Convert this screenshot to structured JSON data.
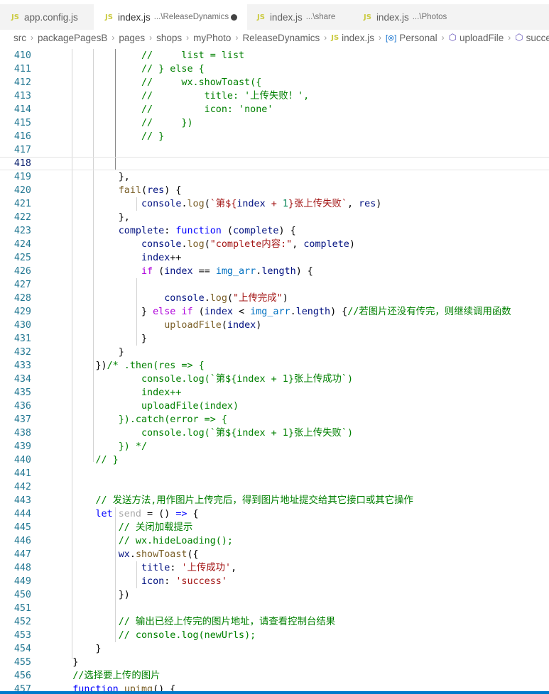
{
  "tabs": [
    {
      "icon": "JS",
      "label": "app.config.js",
      "desc": "",
      "active": false,
      "dirty": false
    },
    {
      "icon": "JS",
      "label": "index.js",
      "desc": "...\\ReleaseDynamics",
      "active": true,
      "dirty": true
    },
    {
      "icon": "JS",
      "label": "index.js",
      "desc": "...\\share",
      "active": false,
      "dirty": false
    },
    {
      "icon": "JS",
      "label": "index.js",
      "desc": "...\\Photos",
      "active": false,
      "dirty": false
    }
  ],
  "breadcrumb": [
    {
      "text": "src",
      "icon": ""
    },
    {
      "text": "packagePagesB",
      "icon": ""
    },
    {
      "text": "pages",
      "icon": ""
    },
    {
      "text": "shops",
      "icon": ""
    },
    {
      "text": "myPhoto",
      "icon": ""
    },
    {
      "text": "ReleaseDynamics",
      "icon": ""
    },
    {
      "text": "index.js",
      "icon": "js-file-icon"
    },
    {
      "text": "Personal",
      "icon": "variable-icon"
    },
    {
      "text": "uploadFile",
      "icon": "method-cube-icon"
    },
    {
      "text": "success",
      "icon": "method-cube-icon"
    }
  ],
  "current_line": 418,
  "code_lines": [
    {
      "n": 410,
      "toks": [
        [
          "c",
          "                //     list = list"
        ]
      ]
    },
    {
      "n": 411,
      "toks": [
        [
          "c",
          "                // } else {"
        ]
      ]
    },
    {
      "n": 412,
      "toks": [
        [
          "c",
          "                //     wx.showToast({"
        ]
      ]
    },
    {
      "n": 413,
      "toks": [
        [
          "c",
          "                //         title: '上传失败！',"
        ]
      ]
    },
    {
      "n": 414,
      "toks": [
        [
          "c",
          "                //         icon: 'none'"
        ]
      ]
    },
    {
      "n": 415,
      "toks": [
        [
          "c",
          "                //     })"
        ]
      ]
    },
    {
      "n": 416,
      "toks": [
        [
          "c",
          "                // }"
        ]
      ]
    },
    {
      "n": 417,
      "toks": []
    },
    {
      "n": 418,
      "toks": []
    },
    {
      "n": 419,
      "toks": [
        [
          "p",
          "            },"
        ]
      ]
    },
    {
      "n": 420,
      "toks": [
        [
          "p",
          "            "
        ],
        [
          "f",
          "fail"
        ],
        [
          "p",
          "("
        ],
        [
          "v",
          "res"
        ],
        [
          "p",
          ") {"
        ]
      ]
    },
    {
      "n": 421,
      "toks": [
        [
          "p",
          "                "
        ],
        [
          "v",
          "console"
        ],
        [
          "p",
          "."
        ],
        [
          "f",
          "log"
        ],
        [
          "p",
          "("
        ],
        [
          "s",
          "`第${"
        ],
        [
          "v",
          "index"
        ],
        [
          "s",
          " + "
        ],
        [
          "n",
          "1"
        ],
        [
          "s",
          "}张上传失败`"
        ],
        [
          "p",
          ", "
        ],
        [
          "v",
          "res"
        ],
        [
          "p",
          ")"
        ]
      ]
    },
    {
      "n": 422,
      "toks": [
        [
          "p",
          "            },"
        ]
      ]
    },
    {
      "n": 423,
      "toks": [
        [
          "p",
          "            "
        ],
        [
          "v",
          "complete"
        ],
        [
          "p",
          ": "
        ],
        [
          "k",
          "function"
        ],
        [
          "p",
          " ("
        ],
        [
          "v",
          "complete"
        ],
        [
          "p",
          ") {"
        ]
      ]
    },
    {
      "n": 424,
      "toks": [
        [
          "p",
          "                "
        ],
        [
          "v",
          "console"
        ],
        [
          "p",
          "."
        ],
        [
          "f",
          "log"
        ],
        [
          "p",
          "("
        ],
        [
          "s",
          "\"complete内容:\""
        ],
        [
          "p",
          ", "
        ],
        [
          "v",
          "complete"
        ],
        [
          "p",
          ")"
        ]
      ]
    },
    {
      "n": 425,
      "toks": [
        [
          "p",
          "                "
        ],
        [
          "v",
          "index"
        ],
        [
          "p",
          "++"
        ]
      ]
    },
    {
      "n": 426,
      "toks": [
        [
          "p",
          "                "
        ],
        [
          "m",
          "if"
        ],
        [
          "p",
          " ("
        ],
        [
          "v",
          "index"
        ],
        [
          "p",
          " == "
        ],
        [
          "pl",
          "img_arr"
        ],
        [
          "p",
          "."
        ],
        [
          "v",
          "length"
        ],
        [
          "p",
          ") {"
        ]
      ]
    },
    {
      "n": 427,
      "toks": []
    },
    {
      "n": 428,
      "toks": [
        [
          "p",
          "                    "
        ],
        [
          "v",
          "console"
        ],
        [
          "p",
          "."
        ],
        [
          "f",
          "log"
        ],
        [
          "p",
          "("
        ],
        [
          "s",
          "\"上传完成\""
        ],
        [
          "p",
          ")"
        ]
      ]
    },
    {
      "n": 429,
      "toks": [
        [
          "p",
          "                } "
        ],
        [
          "m",
          "else if"
        ],
        [
          "p",
          " ("
        ],
        [
          "v",
          "index"
        ],
        [
          "p",
          " < "
        ],
        [
          "pl",
          "img_arr"
        ],
        [
          "p",
          "."
        ],
        [
          "v",
          "length"
        ],
        [
          "p",
          ") {"
        ],
        [
          "c",
          "//若图片还没有传完，则继续调用函数"
        ]
      ]
    },
    {
      "n": 430,
      "toks": [
        [
          "p",
          "                    "
        ],
        [
          "f",
          "uploadFile"
        ],
        [
          "p",
          "("
        ],
        [
          "v",
          "index"
        ],
        [
          "p",
          ")"
        ]
      ]
    },
    {
      "n": 431,
      "toks": [
        [
          "p",
          "                }"
        ]
      ]
    },
    {
      "n": 432,
      "toks": [
        [
          "p",
          "            }"
        ]
      ]
    },
    {
      "n": 433,
      "toks": [
        [
          "p",
          "        })"
        ],
        [
          "c",
          "/* .then(res => {"
        ]
      ]
    },
    {
      "n": 434,
      "toks": [
        [
          "c",
          "                console.log(`第${index + 1}张上传成功`)"
        ]
      ]
    },
    {
      "n": 435,
      "toks": [
        [
          "c",
          "                index++"
        ]
      ]
    },
    {
      "n": 436,
      "toks": [
        [
          "c",
          "                uploadFile(index)"
        ]
      ]
    },
    {
      "n": 437,
      "toks": [
        [
          "c",
          "            }).catch(error => {"
        ]
      ]
    },
    {
      "n": 438,
      "toks": [
        [
          "c",
          "                console.log(`第${index + 1}张上传失败`)"
        ]
      ]
    },
    {
      "n": 439,
      "toks": [
        [
          "c",
          "            }) */"
        ]
      ]
    },
    {
      "n": 440,
      "toks": [
        [
          "c",
          "        // }"
        ]
      ]
    },
    {
      "n": 441,
      "toks": []
    },
    {
      "n": 442,
      "toks": []
    },
    {
      "n": 443,
      "toks": [
        [
          "c",
          "        // 发送方法,用作图片上传完后，得到图片地址提交给其它接口或其它操作"
        ]
      ]
    },
    {
      "n": 444,
      "toks": [
        [
          "p",
          "        "
        ],
        [
          "k",
          "let"
        ],
        [
          "p",
          " "
        ],
        [
          "un",
          "send"
        ],
        [
          "p",
          " = () "
        ],
        [
          "k",
          "=>"
        ],
        [
          "p",
          " {"
        ]
      ]
    },
    {
      "n": 445,
      "toks": [
        [
          "c",
          "            // 关闭加载提示"
        ]
      ]
    },
    {
      "n": 446,
      "toks": [
        [
          "c",
          "            // wx.hideLoading();"
        ]
      ]
    },
    {
      "n": 447,
      "toks": [
        [
          "p",
          "            "
        ],
        [
          "v",
          "wx"
        ],
        [
          "p",
          "."
        ],
        [
          "f",
          "showToast"
        ],
        [
          "p",
          "({"
        ]
      ]
    },
    {
      "n": 448,
      "toks": [
        [
          "p",
          "                "
        ],
        [
          "v",
          "title"
        ],
        [
          "p",
          ": "
        ],
        [
          "s",
          "'上传成功'"
        ],
        [
          "p",
          ","
        ]
      ]
    },
    {
      "n": 449,
      "toks": [
        [
          "p",
          "                "
        ],
        [
          "v",
          "icon"
        ],
        [
          "p",
          ": "
        ],
        [
          "s",
          "'success'"
        ]
      ]
    },
    {
      "n": 450,
      "toks": [
        [
          "p",
          "            })"
        ]
      ]
    },
    {
      "n": 451,
      "toks": []
    },
    {
      "n": 452,
      "toks": [
        [
          "c",
          "            // 输出已经上传完的图片地址，请查看控制台结果"
        ]
      ]
    },
    {
      "n": 453,
      "toks": [
        [
          "c",
          "            // console.log(newUrls);"
        ]
      ]
    },
    {
      "n": 454,
      "toks": [
        [
          "p",
          "        }"
        ]
      ]
    },
    {
      "n": 455,
      "toks": [
        [
          "p",
          "    }"
        ]
      ]
    },
    {
      "n": 456,
      "toks": [
        [
          "c",
          "    //选择要上传的图片"
        ]
      ]
    },
    {
      "n": 457,
      "toks": [
        [
          "p",
          "    "
        ],
        [
          "k",
          "function"
        ],
        [
          "p",
          " "
        ],
        [
          "f",
          "upimg"
        ],
        [
          "p",
          "() {"
        ]
      ]
    }
  ]
}
